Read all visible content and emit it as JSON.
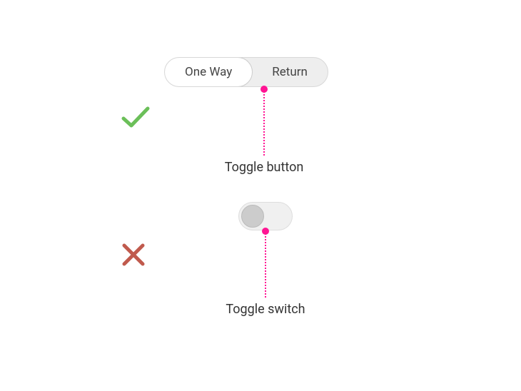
{
  "example_good": {
    "status": "correct",
    "control": {
      "type": "segmented-toggle",
      "options": [
        "One Way",
        "Return"
      ],
      "selected_index": 0
    },
    "label": "Toggle button"
  },
  "example_bad": {
    "status": "incorrect",
    "control": {
      "type": "switch",
      "state": "off"
    },
    "label": "Toggle switch"
  },
  "colors": {
    "accent_pink": "#ff1493",
    "success_green": "#6bbf59",
    "error_red": "#c05a4d"
  }
}
